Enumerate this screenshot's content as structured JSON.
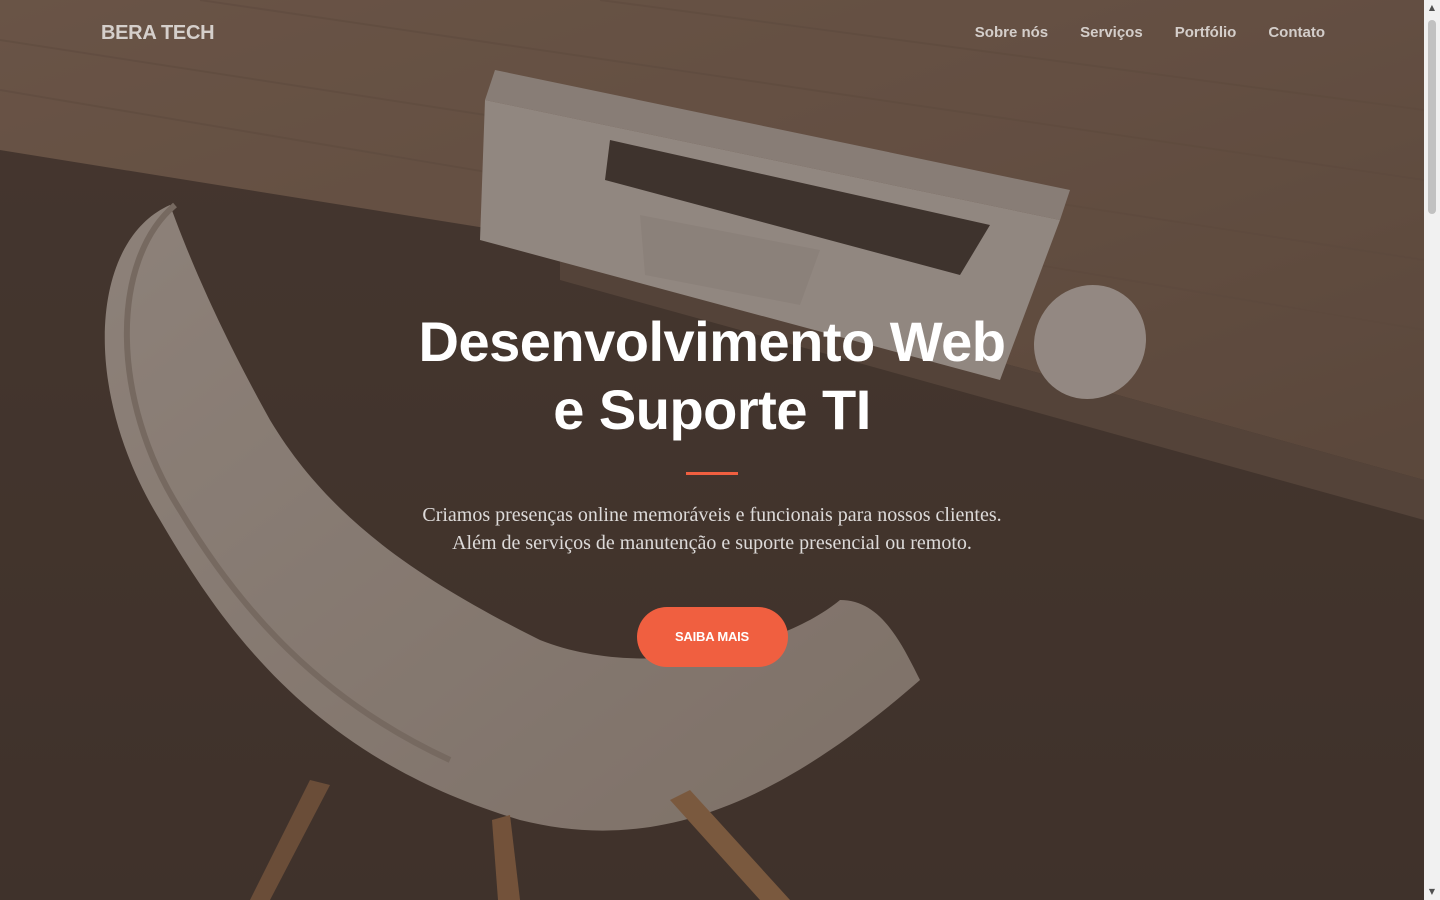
{
  "navbar": {
    "brand": "BERA TECH",
    "links": [
      "Sobre nós",
      "Serviços",
      "Portfólio",
      "Contato"
    ]
  },
  "hero": {
    "title_line1": "Desenvolvimento Web",
    "title_line2": "e Suporte TI",
    "text_line1": "Criamos presenças online memoráveis e funcionais para nossos clientes.",
    "text_line2": "Além de serviços de manutenção e suporte presencial ou remoto.",
    "cta_label": "SAIBA MAIS"
  },
  "colors": {
    "accent": "#f05f40",
    "overlay": "#4e3e34"
  },
  "icons": {
    "scroll_up": "chevron-up-icon",
    "scroll_down": "chevron-down-icon"
  }
}
